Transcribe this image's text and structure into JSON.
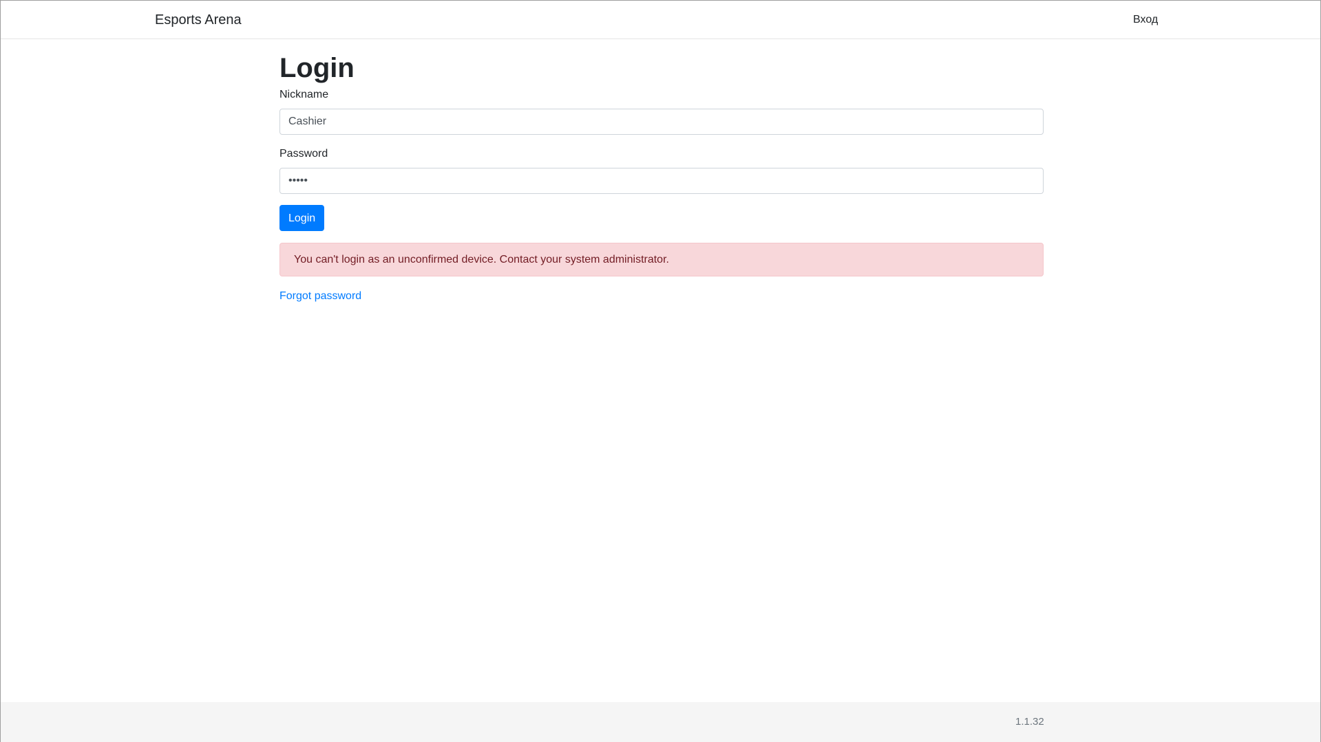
{
  "navbar": {
    "brand": "Esports Arena",
    "login_link": "Вход"
  },
  "main": {
    "title": "Login",
    "nickname": {
      "label": "Nickname",
      "value": "Cashier"
    },
    "password": {
      "label": "Password",
      "value": "•••••"
    },
    "submit_label": "Login",
    "alert_message": "You can't login as an unconfirmed device. Contact your system administrator.",
    "forgot_link": "Forgot password"
  },
  "footer": {
    "version": "1.1.32"
  },
  "colors": {
    "primary": "#007bff",
    "alert_bg": "#f8d7da",
    "alert_text": "#721c24",
    "footer_bg": "#f5f5f5"
  }
}
